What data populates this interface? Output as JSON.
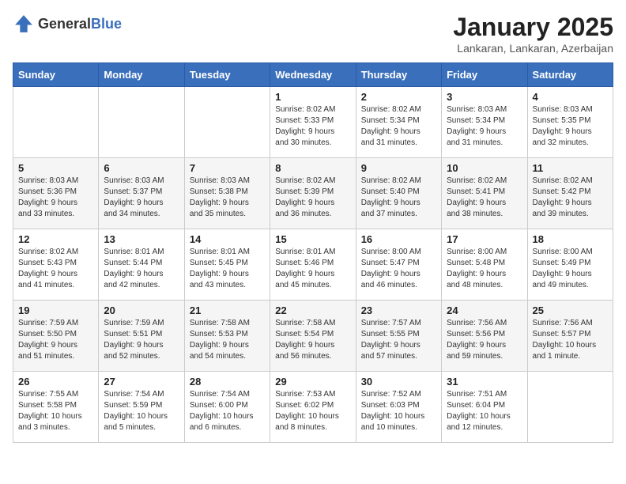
{
  "header": {
    "logo_general": "General",
    "logo_blue": "Blue",
    "title": "January 2025",
    "subtitle": "Lankaran, Lankaran, Azerbaijan"
  },
  "calendar": {
    "days_of_week": [
      "Sunday",
      "Monday",
      "Tuesday",
      "Wednesday",
      "Thursday",
      "Friday",
      "Saturday"
    ],
    "weeks": [
      [
        {
          "day": "",
          "info": ""
        },
        {
          "day": "",
          "info": ""
        },
        {
          "day": "",
          "info": ""
        },
        {
          "day": "1",
          "info": "Sunrise: 8:02 AM\nSunset: 5:33 PM\nDaylight: 9 hours\nand 30 minutes."
        },
        {
          "day": "2",
          "info": "Sunrise: 8:02 AM\nSunset: 5:34 PM\nDaylight: 9 hours\nand 31 minutes."
        },
        {
          "day": "3",
          "info": "Sunrise: 8:03 AM\nSunset: 5:34 PM\nDaylight: 9 hours\nand 31 minutes."
        },
        {
          "day": "4",
          "info": "Sunrise: 8:03 AM\nSunset: 5:35 PM\nDaylight: 9 hours\nand 32 minutes."
        }
      ],
      [
        {
          "day": "5",
          "info": "Sunrise: 8:03 AM\nSunset: 5:36 PM\nDaylight: 9 hours\nand 33 minutes."
        },
        {
          "day": "6",
          "info": "Sunrise: 8:03 AM\nSunset: 5:37 PM\nDaylight: 9 hours\nand 34 minutes."
        },
        {
          "day": "7",
          "info": "Sunrise: 8:03 AM\nSunset: 5:38 PM\nDaylight: 9 hours\nand 35 minutes."
        },
        {
          "day": "8",
          "info": "Sunrise: 8:02 AM\nSunset: 5:39 PM\nDaylight: 9 hours\nand 36 minutes."
        },
        {
          "day": "9",
          "info": "Sunrise: 8:02 AM\nSunset: 5:40 PM\nDaylight: 9 hours\nand 37 minutes."
        },
        {
          "day": "10",
          "info": "Sunrise: 8:02 AM\nSunset: 5:41 PM\nDaylight: 9 hours\nand 38 minutes."
        },
        {
          "day": "11",
          "info": "Sunrise: 8:02 AM\nSunset: 5:42 PM\nDaylight: 9 hours\nand 39 minutes."
        }
      ],
      [
        {
          "day": "12",
          "info": "Sunrise: 8:02 AM\nSunset: 5:43 PM\nDaylight: 9 hours\nand 41 minutes."
        },
        {
          "day": "13",
          "info": "Sunrise: 8:01 AM\nSunset: 5:44 PM\nDaylight: 9 hours\nand 42 minutes."
        },
        {
          "day": "14",
          "info": "Sunrise: 8:01 AM\nSunset: 5:45 PM\nDaylight: 9 hours\nand 43 minutes."
        },
        {
          "day": "15",
          "info": "Sunrise: 8:01 AM\nSunset: 5:46 PM\nDaylight: 9 hours\nand 45 minutes."
        },
        {
          "day": "16",
          "info": "Sunrise: 8:00 AM\nSunset: 5:47 PM\nDaylight: 9 hours\nand 46 minutes."
        },
        {
          "day": "17",
          "info": "Sunrise: 8:00 AM\nSunset: 5:48 PM\nDaylight: 9 hours\nand 48 minutes."
        },
        {
          "day": "18",
          "info": "Sunrise: 8:00 AM\nSunset: 5:49 PM\nDaylight: 9 hours\nand 49 minutes."
        }
      ],
      [
        {
          "day": "19",
          "info": "Sunrise: 7:59 AM\nSunset: 5:50 PM\nDaylight: 9 hours\nand 51 minutes."
        },
        {
          "day": "20",
          "info": "Sunrise: 7:59 AM\nSunset: 5:51 PM\nDaylight: 9 hours\nand 52 minutes."
        },
        {
          "day": "21",
          "info": "Sunrise: 7:58 AM\nSunset: 5:53 PM\nDaylight: 9 hours\nand 54 minutes."
        },
        {
          "day": "22",
          "info": "Sunrise: 7:58 AM\nSunset: 5:54 PM\nDaylight: 9 hours\nand 56 minutes."
        },
        {
          "day": "23",
          "info": "Sunrise: 7:57 AM\nSunset: 5:55 PM\nDaylight: 9 hours\nand 57 minutes."
        },
        {
          "day": "24",
          "info": "Sunrise: 7:56 AM\nSunset: 5:56 PM\nDaylight: 9 hours\nand 59 minutes."
        },
        {
          "day": "25",
          "info": "Sunrise: 7:56 AM\nSunset: 5:57 PM\nDaylight: 10 hours\nand 1 minute."
        }
      ],
      [
        {
          "day": "26",
          "info": "Sunrise: 7:55 AM\nSunset: 5:58 PM\nDaylight: 10 hours\nand 3 minutes."
        },
        {
          "day": "27",
          "info": "Sunrise: 7:54 AM\nSunset: 5:59 PM\nDaylight: 10 hours\nand 5 minutes."
        },
        {
          "day": "28",
          "info": "Sunrise: 7:54 AM\nSunset: 6:00 PM\nDaylight: 10 hours\nand 6 minutes."
        },
        {
          "day": "29",
          "info": "Sunrise: 7:53 AM\nSunset: 6:02 PM\nDaylight: 10 hours\nand 8 minutes."
        },
        {
          "day": "30",
          "info": "Sunrise: 7:52 AM\nSunset: 6:03 PM\nDaylight: 10 hours\nand 10 minutes."
        },
        {
          "day": "31",
          "info": "Sunrise: 7:51 AM\nSunset: 6:04 PM\nDaylight: 10 hours\nand 12 minutes."
        },
        {
          "day": "",
          "info": ""
        }
      ]
    ]
  }
}
